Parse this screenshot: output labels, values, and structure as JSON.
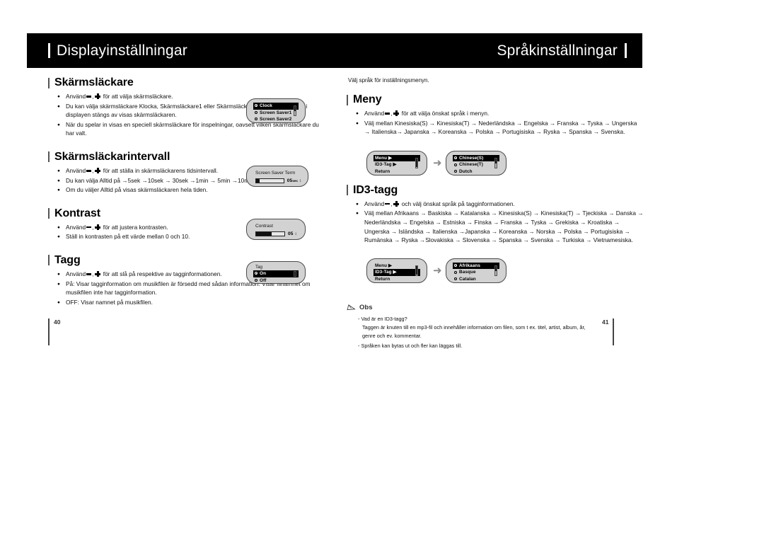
{
  "header": {
    "left_title": "Displayinställningar",
    "right_title": "Språkinställningar"
  },
  "left_page": {
    "page_number": "40",
    "sections": [
      {
        "heading": "Skärmsläckare",
        "bullets": [
          "Använd − , + för att välja skärmsläckare.",
          "Du kan välja skärmsläckare Klocka, Skärmsläckare1 eller Skärmsläckare2. När belysningen i displayen stängs av visas skärmsläckaren.",
          "När du spelar in visas en speciell skärmsläckare för inspelningar, oavsett vilken skärmsläckare du har valt."
        ]
      },
      {
        "heading": "Skärmsläckarintervall",
        "bullets": [
          "Använd − , + för att ställa in skärmsläckarens tidsintervall.",
          "Du kan välja Alltid på →5sek →10sek → 30sek →1min → 5min →10min → av.",
          "Om du väljer Alltid på visas skärmsläckaren hela tiden."
        ]
      },
      {
        "heading": "Kontrast",
        "bullets": [
          "Använd − , + för att justera kontrasten.",
          "Ställ in kontrasten på ett värde mellan 0 och 10."
        ]
      },
      {
        "heading": "Tagg",
        "bullets": [
          "Använd − , + för att slå på respektive av tagginformationen.",
          "På: Visar tagginformation om musikfilen är försedd med sådan information. Visar filnamnet om musikfilen inte har tagginformation.",
          "OFF: Visar namnet på musikfilen."
        ]
      }
    ],
    "screens": {
      "screensaver": {
        "rows": [
          {
            "label": "Clock",
            "selected": true
          },
          {
            "label": "Screen Saver1",
            "selected": false
          },
          {
            "label": "Screen Saver2",
            "selected": false
          }
        ]
      },
      "screen_saver_term": {
        "title": "Screen Saver Term",
        "value": "05",
        "unit": "sec",
        "fill_percent": 14
      },
      "contrast": {
        "title": "Contrast",
        "value": "05",
        "fill_percent": 55
      },
      "tag": {
        "title": "Tag",
        "rows": [
          {
            "label": "On",
            "selected": true
          },
          {
            "label": "Off",
            "selected": false
          }
        ]
      }
    }
  },
  "right_page": {
    "page_number": "41",
    "intro": "Välj språk för inställningsmenyn.",
    "sections": [
      {
        "heading": "Meny",
        "bullets": [
          "Använd − , + för att välja önskat språk i menyn.",
          "Välj mellan Kinesiska(S) → Kinesiska(T) → Nederländska →  Engelska → Franska → Tyska → Ungerska → Italienska→ Japanska → Koreanska → Polska → Portugisiska → Ryska → Spanska → Svenska."
        ]
      },
      {
        "heading": "ID3-tagg",
        "bullets": [
          "Använd − , + och välj önskat språk på tagginformationen.",
          "Välj mellan Afrikaans → Baskiska → Katalanska → Kinesiska(S) → Kinesiska(T) → Tjeckiska → Danska → Nederländska → Engelska → Estniska → Finska  → Franska → Tyska → Grekiska → Kroatiska → Ungerska → Isländska → Italienska →Japanska → Koreanska → Norska → Polska → Portugisiska → Rumänska → Ryska →Slovakiska → Slovenska → Spanska → Svenska → Turkiska  → Vietnamesiska."
        ]
      }
    ],
    "screens": {
      "menu_flow_1": {
        "left": {
          "rows": [
            {
              "label": "Menu ▶",
              "selected": true
            },
            {
              "label": "ID3-Tag ▶",
              "selected": false
            },
            {
              "label": "Return",
              "selected": false
            }
          ]
        },
        "right": {
          "rows": [
            {
              "label": "Chinese(S)",
              "selected": true
            },
            {
              "label": "Chinese(T)",
              "selected": false
            },
            {
              "label": "Dutch",
              "selected": false
            }
          ]
        }
      },
      "menu_flow_2": {
        "left": {
          "rows": [
            {
              "label": "Menu ▶",
              "selected": false
            },
            {
              "label": "ID3-Tag ▶",
              "selected": true
            },
            {
              "label": "Return",
              "selected": false
            }
          ]
        },
        "right": {
          "rows": [
            {
              "label": "Afrikaans",
              "selected": true
            },
            {
              "label": "Basque",
              "selected": false
            },
            {
              "label": "Catalan",
              "selected": false
            }
          ]
        }
      }
    },
    "note": {
      "title": "Obs",
      "lines": [
        "- Vad är en ID3-tagg?",
        "Taggen är knuten till en mp3-fil och innehåller information om filen, som t ex. titel, artist, album, år,",
        "genre och ev. kommentar.",
        "- Språken kan bytas ut och fler kan läggas till."
      ]
    }
  }
}
